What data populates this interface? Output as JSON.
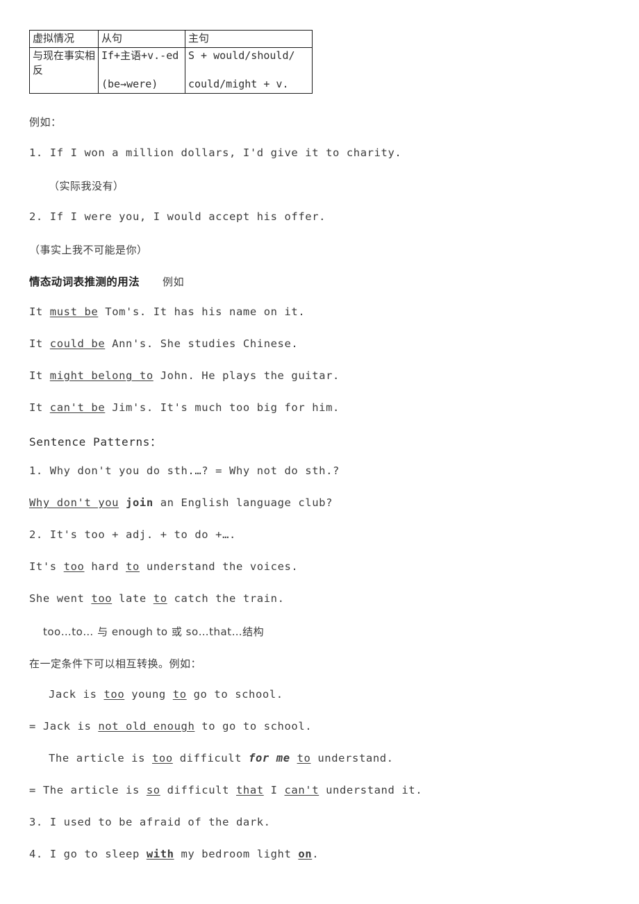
{
  "document": {
    "table": {
      "name": "subjunctive-mood-table",
      "headers": [
        "虚拟情况",
        "从句",
        "主句"
      ],
      "rows": [
        {
          "condition": "与现在事实相反",
          "clause_line1": "If+主语+v.-ed",
          "clause_line2": "(be→were)",
          "main_line1": "S + would/should/",
          "main_line2": "could/might + v."
        }
      ]
    },
    "examples_label": "例如：",
    "subjunctive_examples": [
      "1. If I won a million dollars, I'd give it to charity.",
      "（实际我没有）",
      "2. If I were you, I would accept his offer.",
      "（事实上我不可能是你）"
    ],
    "modal_section": {
      "heading": "情态动词表推测的用法",
      "heading_suffix": "例如",
      "examples": [
        {
          "before": "It ",
          "underline": "must be",
          "after": " Tom's. It has his name on it."
        },
        {
          "before": "It ",
          "underline": "could be",
          "after": " Ann's. She studies Chinese."
        },
        {
          "before": "It ",
          "underline": "might belong to",
          "after": " John. He plays the guitar."
        },
        {
          "before": "It ",
          "underline": "can't be",
          "after": " Jim's. It's much too big for him."
        }
      ]
    },
    "sentence_patterns": {
      "heading": "Sentence Patterns：",
      "pattern1": {
        "rule": "1. Why don't you do sth.…? = Why not do sth.?",
        "example_underline": "Why don't you",
        "example_bold": "join",
        "example_rest": " an English language club?"
      },
      "pattern2": {
        "rule": "2. It's too + adj. + to do +….",
        "examples": [
          {
            "p1": "It's ",
            "u1": "too",
            "p2": " hard ",
            "u2": "to",
            "p3": " understand the voices."
          },
          {
            "p1": "She went ",
            "u1": "too",
            "p2": " late ",
            "u2": "to",
            "p3": " catch the train."
          }
        ],
        "note_line1": "too…to… 与 enough to 或 so…that…结构",
        "note_line2": "在一定条件下可以相互转换。例如：",
        "conversions": [
          {
            "prefix": "Jack is ",
            "u1": "too",
            "mid": " young ",
            "u2": "to",
            "suffix": " go to school."
          },
          {
            "prefix": "= Jack is ",
            "u1": "not old enough",
            "suffix": " to go to school."
          },
          {
            "prefix": "The article is ",
            "u1": "too",
            "mid": " difficult ",
            "italic": "for me",
            "u2": "to",
            "suffix": " understand."
          },
          {
            "prefix": "= The article is ",
            "u1": "so",
            "mid": " difficult ",
            "u2": "that",
            "mid2": " I ",
            "u3": "can't",
            "suffix": " understand it."
          }
        ]
      },
      "pattern3": "3. I used to be afraid of the dark.",
      "pattern4": {
        "p1": "4. I go to sleep ",
        "b1": "with",
        "p2": " my bedroom light ",
        "b2": "on",
        "p3": "."
      }
    }
  }
}
